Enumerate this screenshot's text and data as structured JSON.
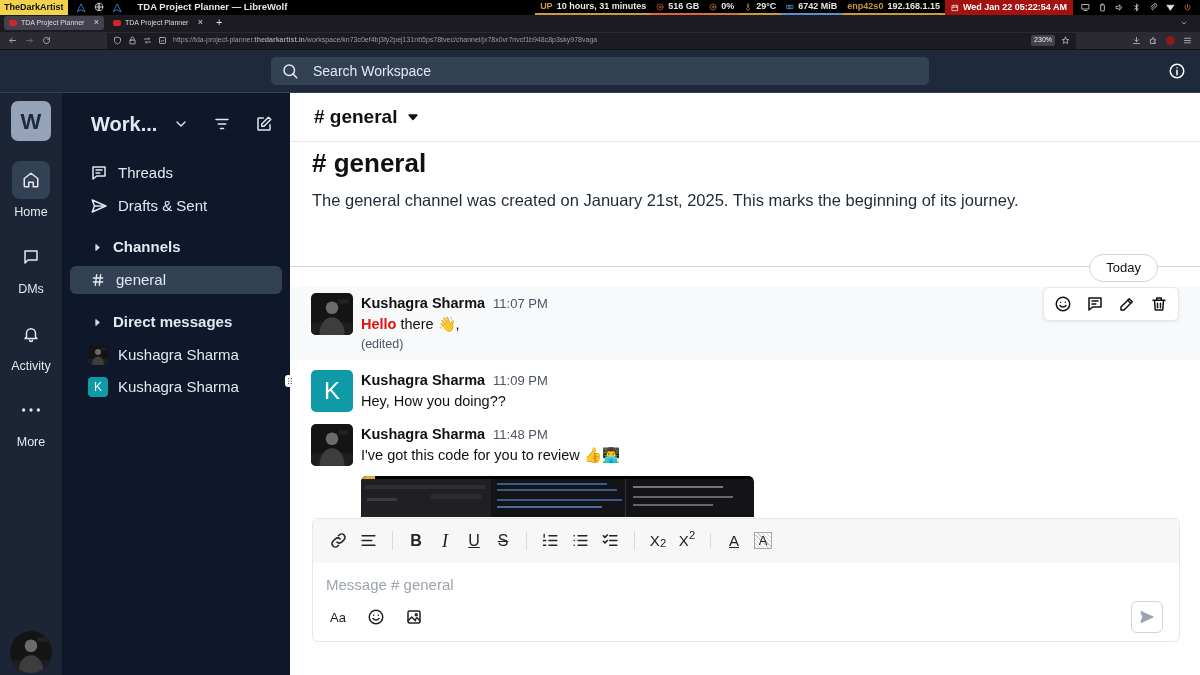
{
  "os_bar": {
    "workspace_label": "TheDarkArtist",
    "window_title": "TDA Project Planner — LibreWolf",
    "stats": [
      {
        "label": "UP",
        "value": "10 hours, 31 minutes",
        "color": "#c99a3e"
      },
      {
        "value": "516 GB",
        "color": "#e0643c"
      },
      {
        "value": "0%",
        "color": "#d07a3a"
      },
      {
        "value": "29°C",
        "color": "#c99a3e"
      },
      {
        "value": "6742 MiB",
        "color": "#5b8fc7"
      },
      {
        "label": "enp42s0",
        "value": "192.168.1.15",
        "color": "#c99a3e"
      }
    ],
    "clock": "Wed Jan 22  05:22:54 AM"
  },
  "browser_tabs": [
    {
      "title": "TDA Project Planner",
      "close": "×",
      "selected": true
    },
    {
      "title": "TDA Project Planner",
      "close": "×",
      "selected": false
    }
  ],
  "new_tab": "+",
  "address": {
    "url": "https://tda-project-planner.**thedarkartist.in**/workspace/kn73c0ef4bj3fy2pej131nb5ps78tvec/channel/jx78x0vr7nvcf1b948c8p3sky978vaga",
    "zoom": "230%"
  },
  "search": {
    "placeholder": "Search Workspace"
  },
  "rail": {
    "workspace_initial": "W",
    "items": [
      {
        "label": "Home",
        "selected": true
      },
      {
        "label": "DMs",
        "selected": false
      },
      {
        "label": "Activity",
        "selected": false
      },
      {
        "label": "More",
        "selected": false
      }
    ]
  },
  "sidebar": {
    "workspace_name": "Work...",
    "links": [
      {
        "label": "Threads"
      },
      {
        "label": "Drafts & Sent"
      }
    ],
    "channels_heading": "Channels",
    "channels": [
      {
        "name": "general",
        "selected": true
      }
    ],
    "dms_heading": "Direct messages",
    "dms": [
      {
        "name": "Kushagra Sharma"
      },
      {
        "name": "Kushagra Sharma",
        "avatar": {
          "kind": "initial",
          "initial": "K"
        }
      }
    ]
  },
  "channel": {
    "title": "# general",
    "intro_title": "# general",
    "intro_text": "The general channel was created on January 21st, 2025. This marks the beginning of its journey."
  },
  "date_divider": "Today",
  "messages": [
    {
      "author": "Kushagra Sharma",
      "time": "11:07 PM",
      "text": "**Hello** there 👋,",
      "edited": "(edited)",
      "hovered": true
    },
    {
      "author": "Kushagra Sharma",
      "time": "11:09 PM",
      "avatar": {
        "kind": "initial",
        "initial": "K"
      },
      "text": "Hey, How you doing??",
      "hovered": false
    },
    {
      "author": "Kushagra Sharma",
      "time": "11:48 PM",
      "text": "I've got this code for you to review 👍👨‍💻",
      "hovered": false
    }
  ],
  "composer": {
    "toolbar": [
      [
        {
          "kind": "link"
        },
        {
          "kind": "align"
        }
      ],
      [
        {
          "kind": "bold",
          "label": "B"
        },
        {
          "kind": "italic",
          "label": "I"
        },
        {
          "kind": "underline",
          "label": "U"
        },
        {
          "kind": "strike",
          "label": "S"
        }
      ],
      [
        {
          "kind": "ordered"
        },
        {
          "kind": "bullet"
        },
        {
          "kind": "tasks"
        }
      ],
      [
        {
          "kind": "subscript",
          "label": "X$_{2}$"
        },
        {
          "kind": "superscript",
          "label": "X$^{2}$"
        }
      ],
      [
        {
          "kind": "text-color",
          "label": "A"
        },
        {
          "kind": "highlight",
          "label": "A"
        }
      ]
    ],
    "placeholder": "Message # general",
    "format_label": "Aa"
  }
}
